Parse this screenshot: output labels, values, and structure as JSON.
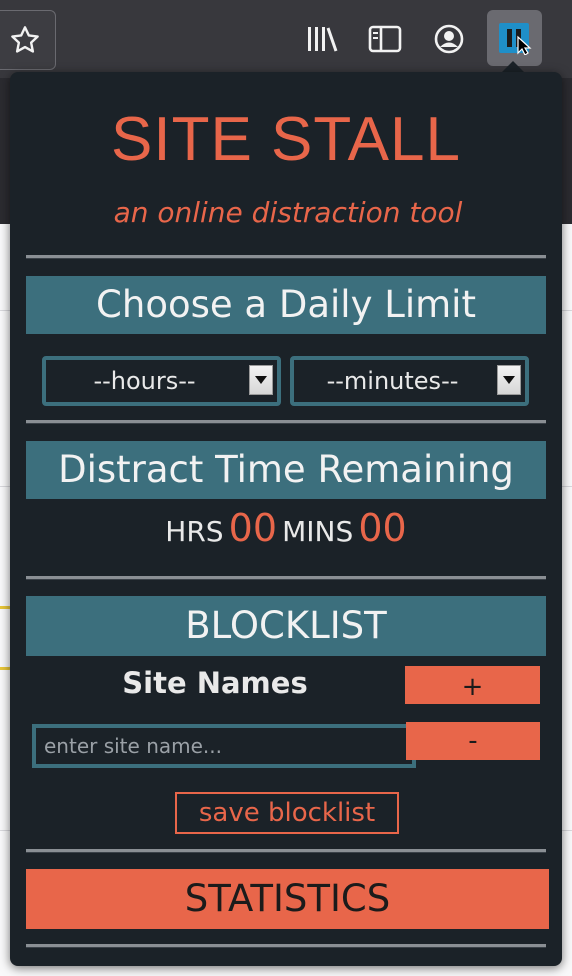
{
  "browser": {
    "toolbar_icons": [
      "star-icon",
      "library-icon",
      "sidebar-icon",
      "account-icon",
      "extension-pause-icon"
    ]
  },
  "popup": {
    "title": "SITE STALL",
    "subtitle": "an online distraction tool",
    "daily_limit": {
      "heading": "Choose a Daily Limit",
      "hours_selected": "--hours--",
      "minutes_selected": "--minutes--"
    },
    "remaining": {
      "heading": "Distract Time Remaining",
      "hrs_label": "HRS",
      "hrs_value": "00",
      "mins_label": "MINS",
      "mins_value": "00"
    },
    "blocklist": {
      "heading": "BLOCKLIST",
      "site_names_label": "Site Names",
      "add_label": "+",
      "remove_label": "-",
      "input_placeholder": "enter site name...",
      "input_value": "",
      "save_label": "save blocklist"
    },
    "statistics_label": "STATISTICS"
  },
  "colors": {
    "accent": "#e8664a",
    "band": "#3c6f7d",
    "popup_bg": "#1b2228"
  }
}
